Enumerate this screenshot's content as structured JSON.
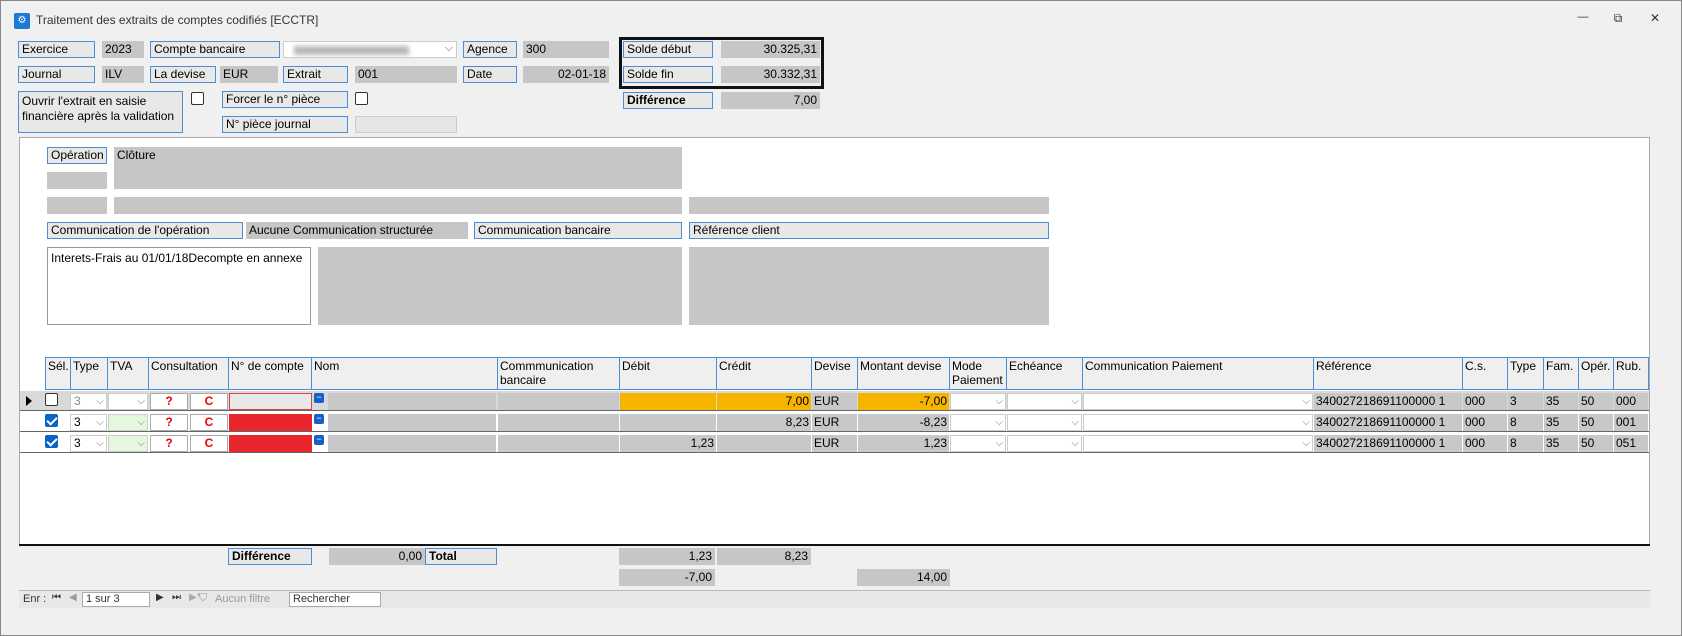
{
  "window": {
    "title": "Traitement des extraits de comptes codifiés [ECCTR]",
    "minimize": "—",
    "restore": "⧉",
    "close": "✕"
  },
  "header": {
    "exercice_label": "Exercice",
    "exercice_value": "2023",
    "compte_label": "Compte bancaire",
    "agence_label": "Agence",
    "agence_value": "300",
    "journal_label": "Journal",
    "journal_value": "ILV",
    "devise_label": "La devise",
    "devise_value": "EUR",
    "extrait_label": "Extrait",
    "extrait_value": "001",
    "date_label": "Date",
    "date_value": "02-01-18",
    "solde_debut_label": "Solde début",
    "solde_debut_value": "30.325,31",
    "solde_fin_label": "Solde fin",
    "solde_fin_value": "30.332,31",
    "difference_label": "Différence",
    "difference_value": "7,00",
    "ouvrir_label": "Ouvrir l'extrait en saisie financière après la validation",
    "forcer_label": "Forcer le n° pièce",
    "npiece_label": "N° pièce journal"
  },
  "detail": {
    "operation_label": "Opération",
    "operation_value": "Clôture",
    "comm_op_label": "Communication de l'opération",
    "aucune_comm": "Aucune Communication structurée",
    "comm_bancaire_label": "Communication bancaire",
    "ref_client_label": "Référence client",
    "comm_text": "Interets-Frais au 01/01/18Decompte en annexe"
  },
  "table": {
    "headers": [
      "Sél.",
      "Type",
      "TVA",
      "Consultation",
      "N° de compte",
      "Nom",
      "Commmunication bancaire",
      "Débit",
      "Crédit",
      "Devise",
      "Montant devise",
      "Mode Paiement",
      "Echéance",
      "Communication Paiement",
      "Référence",
      "C.s.",
      "Type",
      "Fam.",
      "Opér.",
      "Rub."
    ],
    "rows": [
      {
        "sel": false,
        "type": "3",
        "consult_q": "?",
        "consult_c": "C",
        "debit": "",
        "credit": "7,00",
        "devise": "EUR",
        "montant": "-7,00",
        "reference": "340027218691100000 1",
        "cs": "000",
        "type2": "3",
        "fam": "35",
        "oper": "50",
        "rub": "000"
      },
      {
        "sel": true,
        "type": "3",
        "consult_q": "?",
        "consult_c": "C",
        "debit": "",
        "credit": "8,23",
        "devise": "EUR",
        "montant": "-8,23",
        "reference": "340027218691100000 1",
        "cs": "000",
        "type2": "8",
        "fam": "35",
        "oper": "50",
        "rub": "001"
      },
      {
        "sel": true,
        "type": "3",
        "consult_q": "?",
        "consult_c": "C",
        "debit": "1,23",
        "credit": "",
        "devise": "EUR",
        "montant": "1,23",
        "reference": "340027218691100000 1",
        "cs": "000",
        "type2": "8",
        "fam": "35",
        "oper": "50",
        "rub": "051"
      }
    ],
    "footer": {
      "difference_label": "Différence",
      "difference_value": "0,00",
      "total_label": "Total",
      "total_debit": "1,23",
      "total_credit": "8,23",
      "diff_debit": "-7,00",
      "montant_total": "14,00"
    }
  },
  "nav": {
    "enr_label": "Enr :",
    "record": "1 sur 3",
    "filter": "Aucun filtre",
    "search": "Rechercher"
  },
  "colors": {
    "accent": "#4a8fd6",
    "orange": "#f5b400",
    "red": "#e8262c",
    "grey": "#c6c6c6"
  }
}
